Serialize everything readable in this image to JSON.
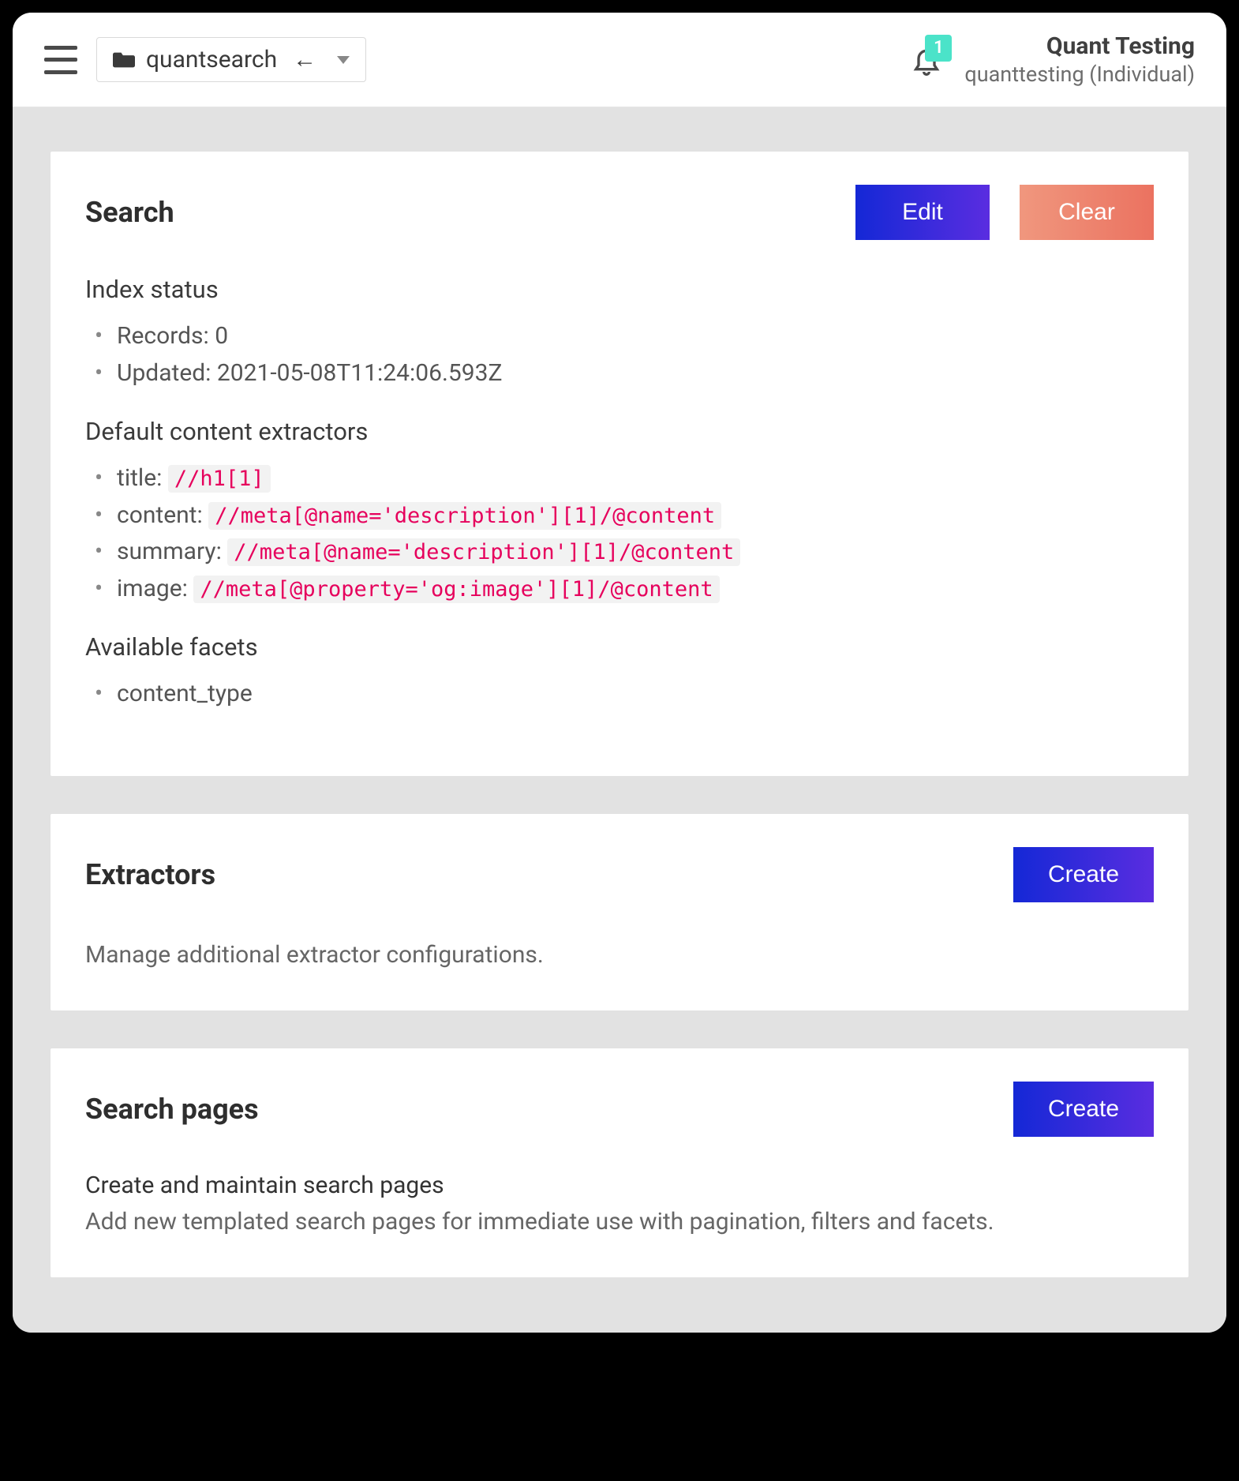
{
  "header": {
    "project_name": "quantsearch",
    "notification_count": "1",
    "org_name": "Quant Testing",
    "account_label": "quanttesting (Individual)"
  },
  "search_card": {
    "title": "Search",
    "edit_label": "Edit",
    "clear_label": "Clear",
    "index_status_heading": "Index status",
    "records_label": "Records: ",
    "records_value": "0",
    "updated_label": "Updated: ",
    "updated_value": "2021-05-08T11:24:06.593Z",
    "extractors_heading": "Default content extractors",
    "extractors": {
      "title_key": "title: ",
      "title_xpath": "//h1[1]",
      "content_key": "content: ",
      "content_xpath": "//meta[@name='description'][1]/@content",
      "summary_key": "summary: ",
      "summary_xpath": "//meta[@name='description'][1]/@content",
      "image_key": "image: ",
      "image_xpath": "//meta[@property='og:image'][1]/@content"
    },
    "facets_heading": "Available facets",
    "facet_0": "content_type"
  },
  "extractors_card": {
    "title": "Extractors",
    "create_label": "Create",
    "description": "Manage additional extractor configurations."
  },
  "pages_card": {
    "title": "Search pages",
    "create_label": "Create",
    "subtitle": "Create and maintain search pages",
    "description": "Add new templated search pages for immediate use with pagination, filters and facets."
  }
}
